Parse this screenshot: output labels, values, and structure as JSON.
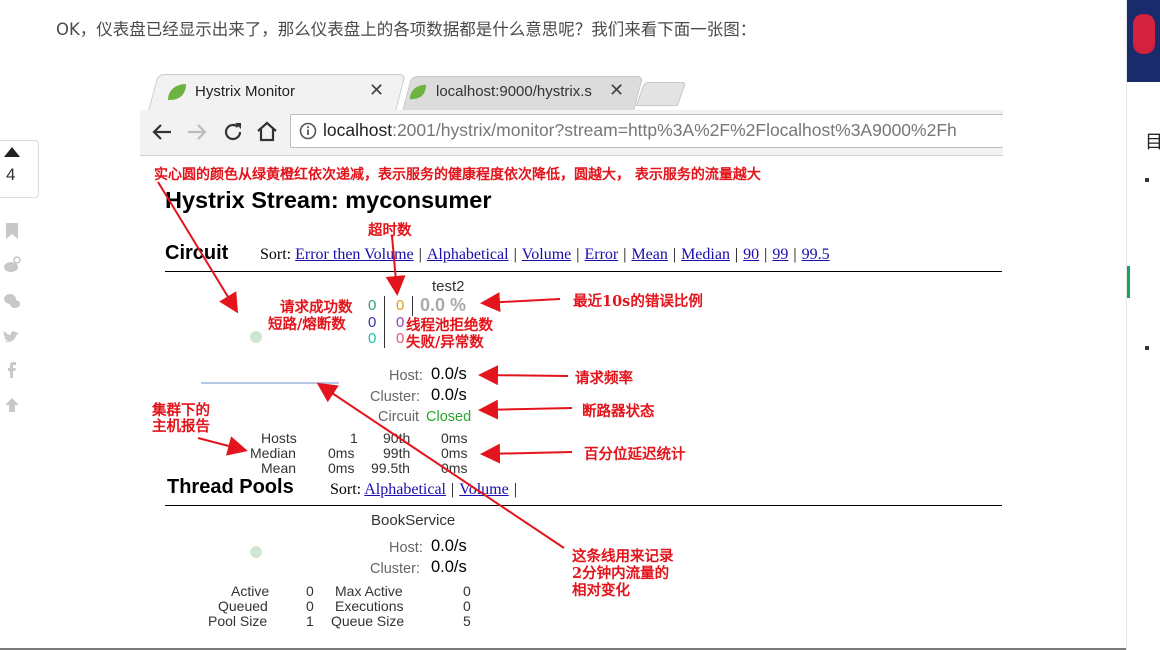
{
  "article": {
    "intro": "OK，仪表盘已经显示出来了，那么仪表盘上的各项数据都是什么意思呢？我们来看下面一张图："
  },
  "sidebar": {
    "vote_count": "4",
    "icons": [
      "upvote-icon",
      "bookmark-icon",
      "weibo-icon",
      "wechat-icon",
      "twitter-icon",
      "facebook-icon",
      "back-to-top-icon"
    ]
  },
  "browser": {
    "tabs": [
      {
        "label": "Hystrix Monitor",
        "active": true
      },
      {
        "label": "localhost:9000/hystrix.s",
        "active": false
      }
    ],
    "url_host": "localhost",
    "url_rest": ":2001/hystrix/monitor?stream=http%3A%2F%2Flocalhost%3A9000%2Fh"
  },
  "dashboard": {
    "title": "Hystrix Stream: myconsumer",
    "circuit_heading": "Circuit",
    "sort_label": "Sort:",
    "circuit_sorts": [
      "Error then Volume",
      "Alphabetical",
      "Volume",
      "Error",
      "Mean",
      "Median",
      "90",
      "99",
      "99.5"
    ],
    "circuit": {
      "name": "test2",
      "success": "0",
      "short_circuited": "0",
      "bad_request": "0",
      "timeout": "0",
      "rejected": "0",
      "failure": "0",
      "error_pct": "0.0 %",
      "host_label": "Host:",
      "host_rate": "0.0/s",
      "cluster_label": "Cluster:",
      "cluster_rate": "0.0/s",
      "circuit_label": "Circuit",
      "circuit_status": "Closed",
      "stats": [
        {
          "label": "Hosts",
          "value": "1",
          "pct": "90th",
          "latency": "0ms"
        },
        {
          "label": "Median",
          "value": "0ms",
          "pct": "99th",
          "latency": "0ms"
        },
        {
          "label": "Mean",
          "value": "0ms",
          "pct": "99.5th",
          "latency": "0ms"
        }
      ]
    },
    "threadpool_heading": "Thread Pools",
    "threadpool_sorts": [
      "Alphabetical",
      "Volume"
    ],
    "pool": {
      "name": "BookService",
      "host_label": "Host:",
      "host_rate": "0.0/s",
      "cluster_label": "Cluster:",
      "cluster_rate": "0.0/s",
      "left": [
        {
          "label": "Active",
          "value": "0"
        },
        {
          "label": "Queued",
          "value": "0"
        },
        {
          "label": "Pool Size",
          "value": "1"
        }
      ],
      "right": [
        {
          "label": "Max Active",
          "value": "0"
        },
        {
          "label": "Executions",
          "value": "0"
        },
        {
          "label": "Queue Size",
          "value": "5"
        }
      ]
    }
  },
  "annotations": {
    "circle": "实心圆的颜色从绿黄橙红依次递减，表示服务的健康程度依次降低，圆越大， 表示服务的流量越大",
    "timeout": "超时数",
    "success": "请求成功数",
    "short": "短路/熔断数",
    "rejected": "线程池拒绝数",
    "failure": "失败/异常数",
    "error_rate": "最近10s的错误比例",
    "request_rate": "请求频率",
    "breaker": "断路器状态",
    "cluster_hosts_1": "集群下的",
    "cluster_hosts_2": "主机报告",
    "percentile": "百分位延迟统计",
    "sparkline_1": "这条线用来记录",
    "sparkline_2": "2分钟内流量的",
    "sparkline_3": "相对变化"
  },
  "colors": {
    "annotation": "#e3141b",
    "success": "#2e9e6b",
    "short": "#3333aa",
    "bad": "#19bba8",
    "timeout": "#d4a017",
    "rejected": "#8e44ad",
    "failure": "#e55a6c",
    "closed": "#2aa52a",
    "link": "#1a0dab"
  }
}
